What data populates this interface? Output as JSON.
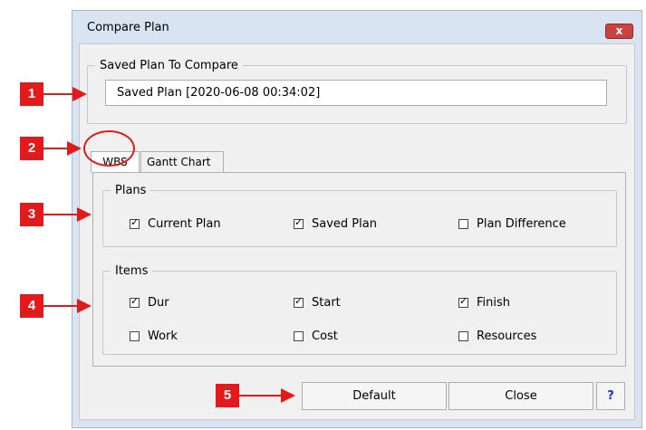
{
  "dialog": {
    "title": "Compare Plan",
    "close_glyph": "x"
  },
  "saved_group": {
    "legend": "Saved Plan To Compare",
    "value": "Saved Plan [2020-06-08 00:34:02]"
  },
  "tabs": [
    {
      "label": "WBS",
      "active": true
    },
    {
      "label": "Gantt Chart",
      "active": false
    }
  ],
  "plans_group": {
    "legend": "Plans",
    "items": [
      {
        "label": "Current Plan",
        "checked": true
      },
      {
        "label": "Saved Plan",
        "checked": true
      },
      {
        "label": "Plan Difference",
        "checked": false
      }
    ]
  },
  "items_group": {
    "legend": "Items",
    "items": [
      {
        "label": "Dur",
        "checked": true
      },
      {
        "label": "Start",
        "checked": true
      },
      {
        "label": "Finish",
        "checked": true
      },
      {
        "label": "Work",
        "checked": false
      },
      {
        "label": "Cost",
        "checked": false
      },
      {
        "label": "Resources",
        "checked": false
      }
    ]
  },
  "buttons": {
    "default": "Default",
    "close": "Close",
    "help": "?"
  },
  "markers": [
    "1",
    "2",
    "3",
    "4",
    "5"
  ],
  "colors": {
    "marker": "#e11b1b",
    "titlebar": "#d8e4f2",
    "close_button": "#c8443c",
    "help_text": "#1a2fd0"
  }
}
